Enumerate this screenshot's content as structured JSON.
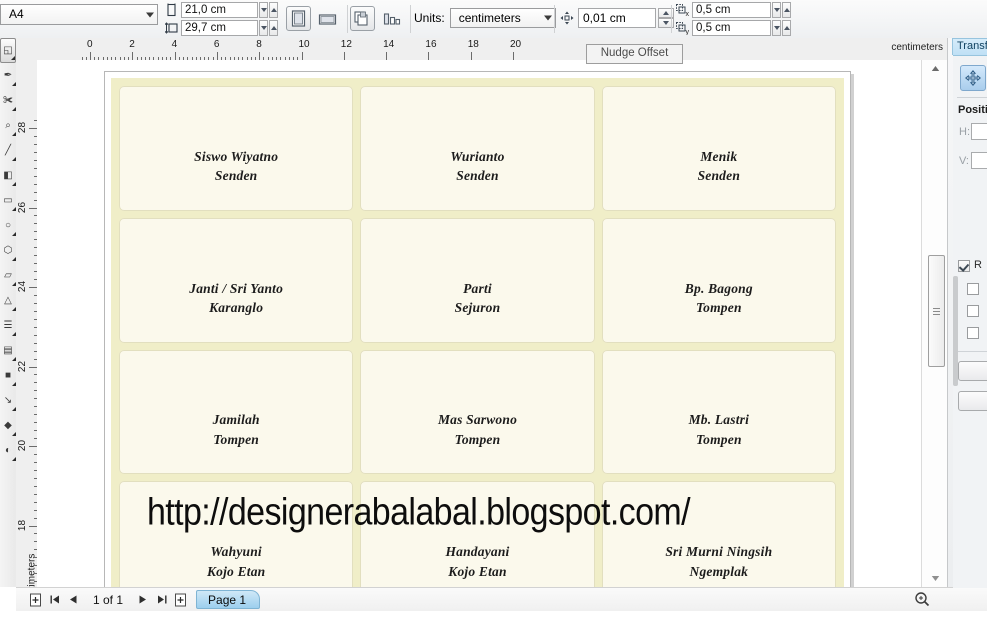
{
  "app": {
    "name": "CorelDRAW",
    "document_type": "vector-drawing"
  },
  "property_bar": {
    "page_size": {
      "value": "A4",
      "icon": "page-size-dropdown"
    },
    "page_width": {
      "label_icon": "page-width-icon",
      "value": "21,0 cm"
    },
    "page_height": {
      "label_icon": "page-height-icon",
      "value": "29,7 cm"
    },
    "orientation": {
      "portrait": {
        "icon": "portrait-icon",
        "selected": true
      },
      "landscape": {
        "icon": "landscape-icon",
        "selected": false
      }
    },
    "page_scope": {
      "all_pages": {
        "icon": "all-pages-icon",
        "selected": true
      },
      "current_page": {
        "icon": "current-page-icon",
        "selected": false
      }
    },
    "units": {
      "label": "Units:",
      "value": "centimeters"
    },
    "nudge": {
      "icon": "nudge-offset-icon",
      "value": "0,01 cm"
    },
    "duplicate_x": {
      "icon": "duplicate-x-icon",
      "label": "x",
      "value": "0,5 cm"
    },
    "duplicate_y": {
      "icon": "duplicate-y-icon",
      "label": "y",
      "value": "0,5 cm"
    }
  },
  "tooltip": {
    "text": "Nudge Offset"
  },
  "toolbox": {
    "tools": [
      {
        "name": "pick-tool",
        "glyph": "◱",
        "selected": true
      },
      {
        "name": "shape-tool",
        "glyph": "✒",
        "selected": false
      },
      {
        "name": "crop-tool",
        "glyph": "✀",
        "selected": false
      },
      {
        "name": "zoom-tool",
        "glyph": "⌕",
        "selected": false
      },
      {
        "name": "freehand-tool",
        "glyph": "╱",
        "selected": false
      },
      {
        "name": "smart-fill-tool",
        "glyph": "◧",
        "selected": false
      },
      {
        "name": "rectangle-tool",
        "glyph": "▭",
        "selected": false
      },
      {
        "name": "ellipse-tool",
        "glyph": "○",
        "selected": false
      },
      {
        "name": "polygon-tool",
        "glyph": "⬡",
        "selected": false
      },
      {
        "name": "basic-shapes-tool",
        "glyph": "▱",
        "selected": false
      },
      {
        "name": "text-tool",
        "glyph": "△",
        "selected": false
      },
      {
        "name": "table-tool",
        "glyph": "☰",
        "selected": false
      },
      {
        "name": "dimension-tool",
        "glyph": "▤",
        "selected": false
      },
      {
        "name": "blend-tool",
        "glyph": "■",
        "selected": false
      },
      {
        "name": "eyedropper-tool",
        "glyph": "↘",
        "selected": false
      },
      {
        "name": "fill-tool",
        "glyph": "◆",
        "selected": false
      },
      {
        "name": "interactive-fill-tool",
        "glyph": "◐",
        "selected": false
      }
    ]
  },
  "rulers": {
    "horizontal": {
      "unit_label": "centimeters",
      "labels": [
        "0",
        "2",
        "4",
        "6",
        "8",
        "10",
        "12",
        "14",
        "16",
        "18",
        "20"
      ]
    },
    "vertical": {
      "unit_label": "centimeters",
      "labels": [
        "28",
        "26",
        "24",
        "22",
        "20",
        "18"
      ]
    }
  },
  "document": {
    "page_background": "#f0eec8",
    "card_background": "#fbf9ec",
    "cards": [
      {
        "name": "Siswo Wiyatno",
        "place": "Senden"
      },
      {
        "name": "Wurianto",
        "place": "Senden"
      },
      {
        "name": "Menik",
        "place": "Senden"
      },
      {
        "name": "Janti / Sri Yanto",
        "place": "Karanglo"
      },
      {
        "name": "Parti",
        "place": "Sejuron"
      },
      {
        "name": "Bp. Bagong",
        "place": "Tompen"
      },
      {
        "name": "Jamilah",
        "place": "Tompen"
      },
      {
        "name": "Mas Sarwono",
        "place": "Tompen"
      },
      {
        "name": "Mb. Lastri",
        "place": "Tompen"
      },
      {
        "name": "Wahyuni",
        "place": "Kojo Etan"
      },
      {
        "name": "Handayani",
        "place": "Kojo Etan"
      },
      {
        "name": "Sri Murni Ningsih",
        "place": "Ngemplak"
      }
    ],
    "watermark": "http://designerabalabal.blogspot.com/"
  },
  "status_bar": {
    "first_page_icon": "first-page-icon",
    "prev_page_icon": "previous-page-icon",
    "next_page_icon": "next-page-icon",
    "last_page_icon": "last-page-icon",
    "add_page_start_icon": "add-page-before-icon",
    "add_page_end_icon": "add-page-after-icon",
    "page_count": "1 of 1",
    "page_tab": "Page 1",
    "zoom_icon": "zoom-level-icon"
  },
  "docker": {
    "tab": "Transfo",
    "position_button_icon": "move-position-icon",
    "section_label": "Positi",
    "h_label": "H:",
    "v_label": "V:",
    "relative_checkbox": {
      "label": "R",
      "checked": true
    },
    "option_checkboxes": [
      {
        "name": "anchor-option-1",
        "checked": false
      },
      {
        "name": "anchor-option-2",
        "checked": false
      },
      {
        "name": "anchor-option-3",
        "checked": false
      }
    ]
  }
}
